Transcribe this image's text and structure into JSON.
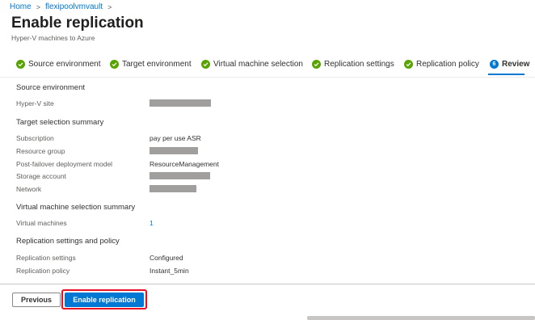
{
  "breadcrumb": {
    "home": "Home",
    "vault": "flexipoolvmvault",
    "separator": ">"
  },
  "header": {
    "title": "Enable replication",
    "subtitle": "Hyper-V machines to Azure",
    "more": "···"
  },
  "tabs": [
    {
      "label": "Source environment"
    },
    {
      "label": "Target environment"
    },
    {
      "label": "Virtual machine selection"
    },
    {
      "label": "Replication settings"
    },
    {
      "label": "Replication policy"
    },
    {
      "label": "Review",
      "number": "6"
    }
  ],
  "review": {
    "source_title": "Source environment",
    "hyperv_site_label": "Hyper-V site",
    "target_title": "Target selection summary",
    "subscription_label": "Subscription",
    "subscription_value": "pay per use ASR",
    "resource_group_label": "Resource group",
    "deployment_model_label": "Post-failover deployment model",
    "deployment_model_value": "ResourceManagement",
    "storage_account_label": "Storage account",
    "network_label": "Network",
    "vm_title": "Virtual machine selection summary",
    "vm_label": "Virtual machines",
    "vm_value": "1",
    "replication_title": "Replication settings and policy",
    "replication_settings_label": "Replication settings",
    "replication_settings_value": "Configured",
    "replication_policy_label": "Replication policy",
    "replication_policy_value": "Instant_5min"
  },
  "footer": {
    "previous": "Previous",
    "enable": "Enable replication"
  },
  "colors": {
    "accent": "#0078d4",
    "success": "#57a300",
    "highlight": "#e81123"
  }
}
